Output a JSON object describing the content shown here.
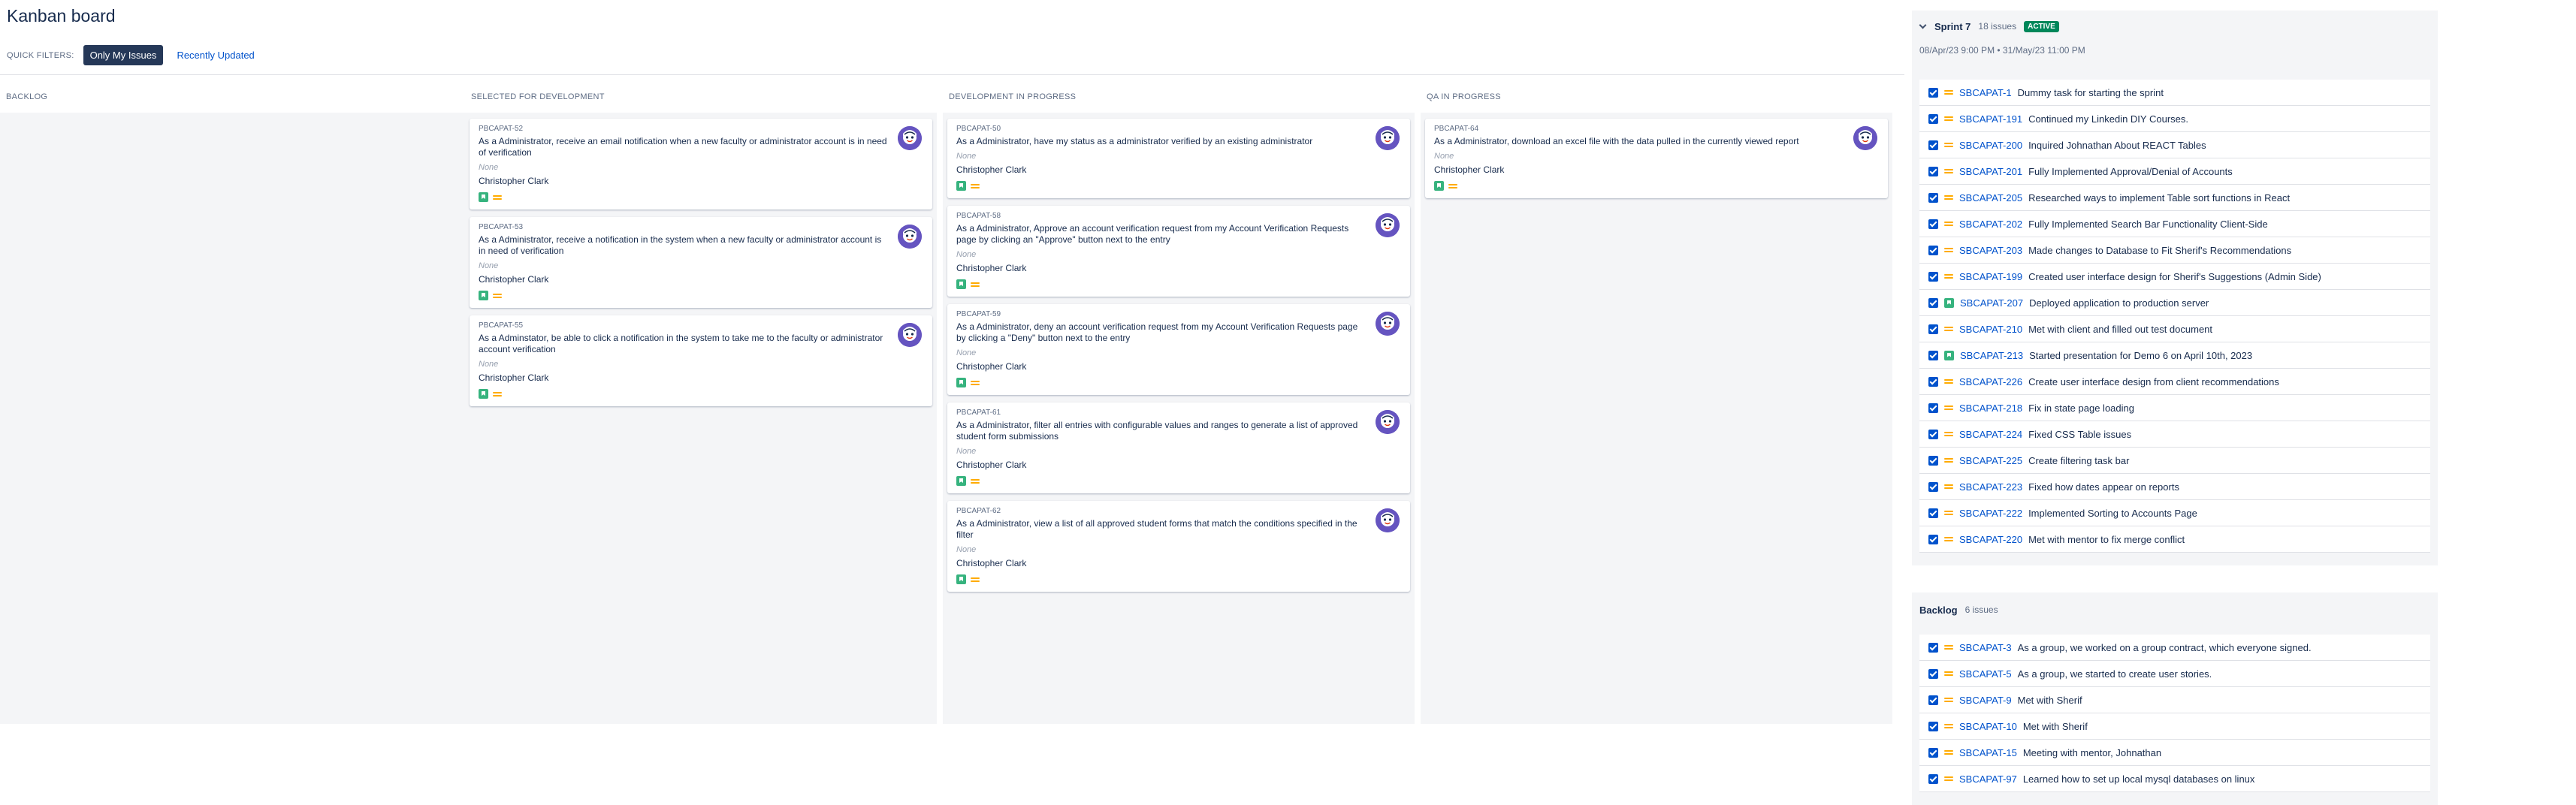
{
  "page": {
    "title": "Kanban board"
  },
  "quick_filters": {
    "label": "QUICK FILTERS:",
    "active": "Only My Issues",
    "link": "Recently Updated"
  },
  "columns": [
    {
      "title": "BACKLOG",
      "cards": []
    },
    {
      "title": "SELECTED FOR DEVELOPMENT",
      "cards": [
        {
          "key": "PBCAPAT-52",
          "summary": "As a Administrator, receive an email notification when a new faculty or administrator account is in need of verification",
          "none": "None",
          "assignee": "Christopher Clark"
        },
        {
          "key": "PBCAPAT-53",
          "summary": "As a Administrator, receive a notification in the system when a new faculty or administrator account is in need of verification",
          "none": "None",
          "assignee": "Christopher Clark"
        },
        {
          "key": "PBCAPAT-55",
          "summary": "As a Adminstator, be able to click a notification in the system to take me to the faculty or administrator account verification",
          "none": "None",
          "assignee": "Christopher Clark"
        }
      ]
    },
    {
      "title": "DEVELOPMENT IN PROGRESS",
      "cards": [
        {
          "key": "PBCAPAT-50",
          "summary": "As a Administrator, have my status as a administrator verified by an existing administrator",
          "none": "None",
          "assignee": "Christopher Clark"
        },
        {
          "key": "PBCAPAT-58",
          "summary": "As a Administrator, Approve an account verification request from my Account Verification Requests page by clicking an \"Approve\" button next to the entry",
          "none": "None",
          "assignee": "Christopher Clark"
        },
        {
          "key": "PBCAPAT-59",
          "summary": "As a Administrator, deny an account verification request from my Account Verification Requests page by clicking a \"Deny\" button next to the entry",
          "none": "None",
          "assignee": "Christopher Clark"
        },
        {
          "key": "PBCAPAT-61",
          "summary": "As a Administrator, filter all entries with configurable values and ranges to generate a list of approved student form submissions",
          "none": "None",
          "assignee": "Christopher Clark"
        },
        {
          "key": "PBCAPAT-62",
          "summary": "As a Administrator, view a list of all approved student forms that match the conditions specified in the filter",
          "none": "None",
          "assignee": "Christopher Clark"
        }
      ]
    },
    {
      "title": "QA IN PROGRESS",
      "cards": [
        {
          "key": "PBCAPAT-64",
          "summary": "As a Administrator, download an excel file with the data pulled in the currently viewed report",
          "none": "None",
          "assignee": "Christopher Clark"
        }
      ]
    }
  ],
  "sprint": {
    "name": "Sprint 7",
    "count": "18 issues",
    "badge": "ACTIVE",
    "dates": "08/Apr/23 9:00 PM  •  31/May/23 11:00 PM",
    "issues": [
      {
        "key": "SBCAPAT-1",
        "summary": "Dummy task for starting the sprint",
        "type": "task"
      },
      {
        "key": "SBCAPAT-191",
        "summary": "Continued my Linkedin DIY Courses.",
        "type": "task"
      },
      {
        "key": "SBCAPAT-200",
        "summary": "Inquired Johnathan About REACT Tables",
        "type": "task"
      },
      {
        "key": "SBCAPAT-201",
        "summary": "Fully Implemented Approval/Denial of Accounts",
        "type": "task"
      },
      {
        "key": "SBCAPAT-205",
        "summary": "Researched ways to implement Table sort functions in React",
        "type": "task"
      },
      {
        "key": "SBCAPAT-202",
        "summary": "Fully Implemented Search Bar Functionality Client-Side",
        "type": "task"
      },
      {
        "key": "SBCAPAT-203",
        "summary": "Made changes to Database to Fit Sherif's Recommendations",
        "type": "task"
      },
      {
        "key": "SBCAPAT-199",
        "summary": "Created user interface design for Sherif's Suggestions (Admin Side)",
        "type": "task"
      },
      {
        "key": "SBCAPAT-207",
        "summary": "Deployed application to production server",
        "type": "story"
      },
      {
        "key": "SBCAPAT-210",
        "summary": "Met with client and filled out test document",
        "type": "task"
      },
      {
        "key": "SBCAPAT-213",
        "summary": "Started presentation for Demo 6 on April 10th, 2023",
        "type": "story"
      },
      {
        "key": "SBCAPAT-226",
        "summary": "Create user interface design from client recommendations",
        "type": "task"
      },
      {
        "key": "SBCAPAT-218",
        "summary": "Fix in state page loading",
        "type": "task"
      },
      {
        "key": "SBCAPAT-224",
        "summary": "Fixed CSS Table issues",
        "type": "task"
      },
      {
        "key": "SBCAPAT-225",
        "summary": "Create filtering task bar",
        "type": "task"
      },
      {
        "key": "SBCAPAT-223",
        "summary": "Fixed how dates appear on reports",
        "type": "task"
      },
      {
        "key": "SBCAPAT-222",
        "summary": "Implemented Sorting to Accounts Page",
        "type": "task"
      },
      {
        "key": "SBCAPAT-220",
        "summary": "Met with mentor to fix merge conflict",
        "type": "task"
      }
    ]
  },
  "backlog": {
    "name": "Backlog",
    "count": "6 issues",
    "issues": [
      {
        "key": "SBCAPAT-3",
        "summary": "As a group, we worked on a group contract, which everyone signed.",
        "type": "task"
      },
      {
        "key": "SBCAPAT-5",
        "summary": "As a group, we started to create user stories.",
        "type": "task"
      },
      {
        "key": "SBCAPAT-9",
        "summary": "Met with Sherif",
        "type": "task"
      },
      {
        "key": "SBCAPAT-10",
        "summary": "Met with Sherif",
        "type": "task"
      },
      {
        "key": "SBCAPAT-15",
        "summary": "Meeting with mentor, Johnathan",
        "type": "task"
      },
      {
        "key": "SBCAPAT-97",
        "summary": "Learned how to set up local mysql databases on linux",
        "type": "task"
      }
    ]
  },
  "colors": {
    "accent": "#0052cc",
    "active_filter": "#253858",
    "badge": "#00875a",
    "story": "#36b37e",
    "priority": "#ffab00",
    "avatar": "#6554c0"
  }
}
